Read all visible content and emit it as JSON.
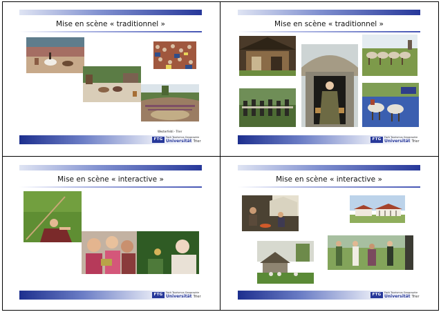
{
  "slides": [
    {
      "title": "Mise en scène « traditionnel »",
      "caption": "Westerfeldi - Trier",
      "logo": {
        "mark": "FTG",
        "top": "Fach Tourismus Geographie",
        "uni": "Universität",
        "city": "Trier"
      },
      "photos": [
        "show-horses-arena-photo",
        "knight-tournament-photo",
        "arena-crowd-photo",
        "amphitheatre-crowd-photo"
      ]
    },
    {
      "title": "Mise en scène « traditionnel »",
      "logo": {
        "mark": "FTG",
        "top": "Fach Tourismus Geographie",
        "uni": "Universität",
        "city": "Trier"
      },
      "photos": [
        "timber-barn-photo",
        "medieval-woman-doorway-photo",
        "draft-horses-photo",
        "army-reenactment-photo",
        "horse-carriage-photo"
      ]
    },
    {
      "title": "Mise en scène « interactive »",
      "logo": {
        "mark": "FTG",
        "top": "Fach Tourismus Geographie",
        "uni": "Universität",
        "city": "Trier"
      },
      "photos": [
        "boy-with-spear-photo",
        "children-craft-photo"
      ]
    },
    {
      "title": "Mise en scène « interactive »",
      "logo": {
        "mark": "FTG",
        "top": "Fach Tourismus Geographie",
        "uni": "Universität",
        "city": "Trier"
      },
      "photos": [
        "campfire-gathering-photo",
        "roman-villa-photo",
        "village-huts-photo",
        "costumed-group-photo"
      ]
    }
  ]
}
